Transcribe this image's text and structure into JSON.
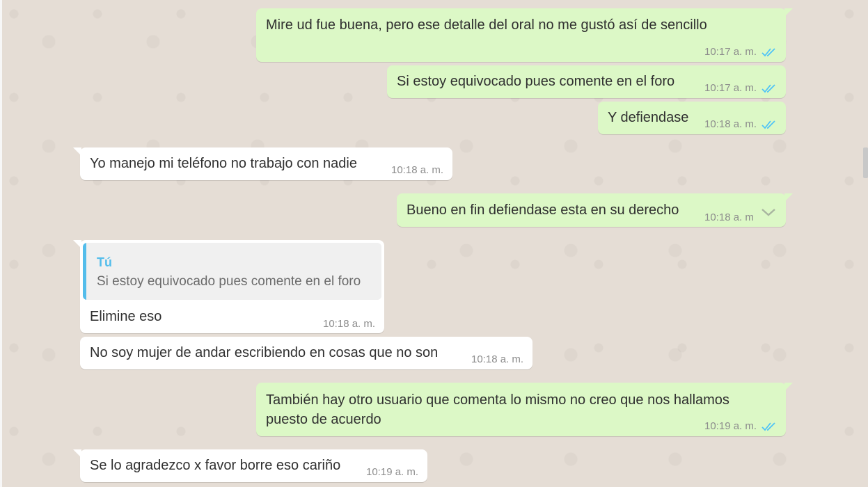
{
  "chat": {
    "messages": [
      {
        "dir": "out",
        "text": "Mire ud fue buena, pero ese detalle del oral no me gustó así de sencillo",
        "time": "10:17 a. m.",
        "status": "read"
      },
      {
        "dir": "out",
        "text": "Si estoy equivocado pues comente en el foro",
        "time": "10:17 a. m.",
        "status": "read"
      },
      {
        "dir": "out",
        "text": "Y defiendase",
        "time": "10:18 a. m.",
        "status": "read"
      },
      {
        "dir": "in",
        "text": "Yo manejo mi teléfono no trabajo con nadie",
        "time": "10:18 a. m."
      },
      {
        "dir": "out",
        "text": "Bueno en fin defiendase esta en su derecho",
        "time": "10:18 a. m",
        "status": "menu"
      },
      {
        "dir": "in",
        "text": "Elimine eso",
        "time": "10:18 a. m.",
        "quote": {
          "author": "Tú",
          "text": "Si estoy equivocado pues comente en el foro"
        }
      },
      {
        "dir": "in",
        "text": "No soy mujer de andar escribiendo en cosas que no son",
        "time": "10:18 a. m."
      },
      {
        "dir": "out",
        "text_line1": "También hay otro usuario que comenta lo mismo no creo que nos hallamos",
        "text_line2": "puesto de acuerdo",
        "time": "10:19 a. m.",
        "status": "read"
      },
      {
        "dir": "in",
        "text": "Se lo agradezco x favor borre eso cariño",
        "time": "10:19 a. m."
      }
    ]
  },
  "colors": {
    "outgoing_bubble": "#dcf8c6",
    "incoming_bubble": "#ffffff",
    "read_ticks": "#4fc3f7",
    "quote_accent": "#53bdeb",
    "wallpaper": "#e5ddd5"
  },
  "icons": {
    "read_receipt": "double-check-icon",
    "message_menu": "chevron-down-icon"
  }
}
